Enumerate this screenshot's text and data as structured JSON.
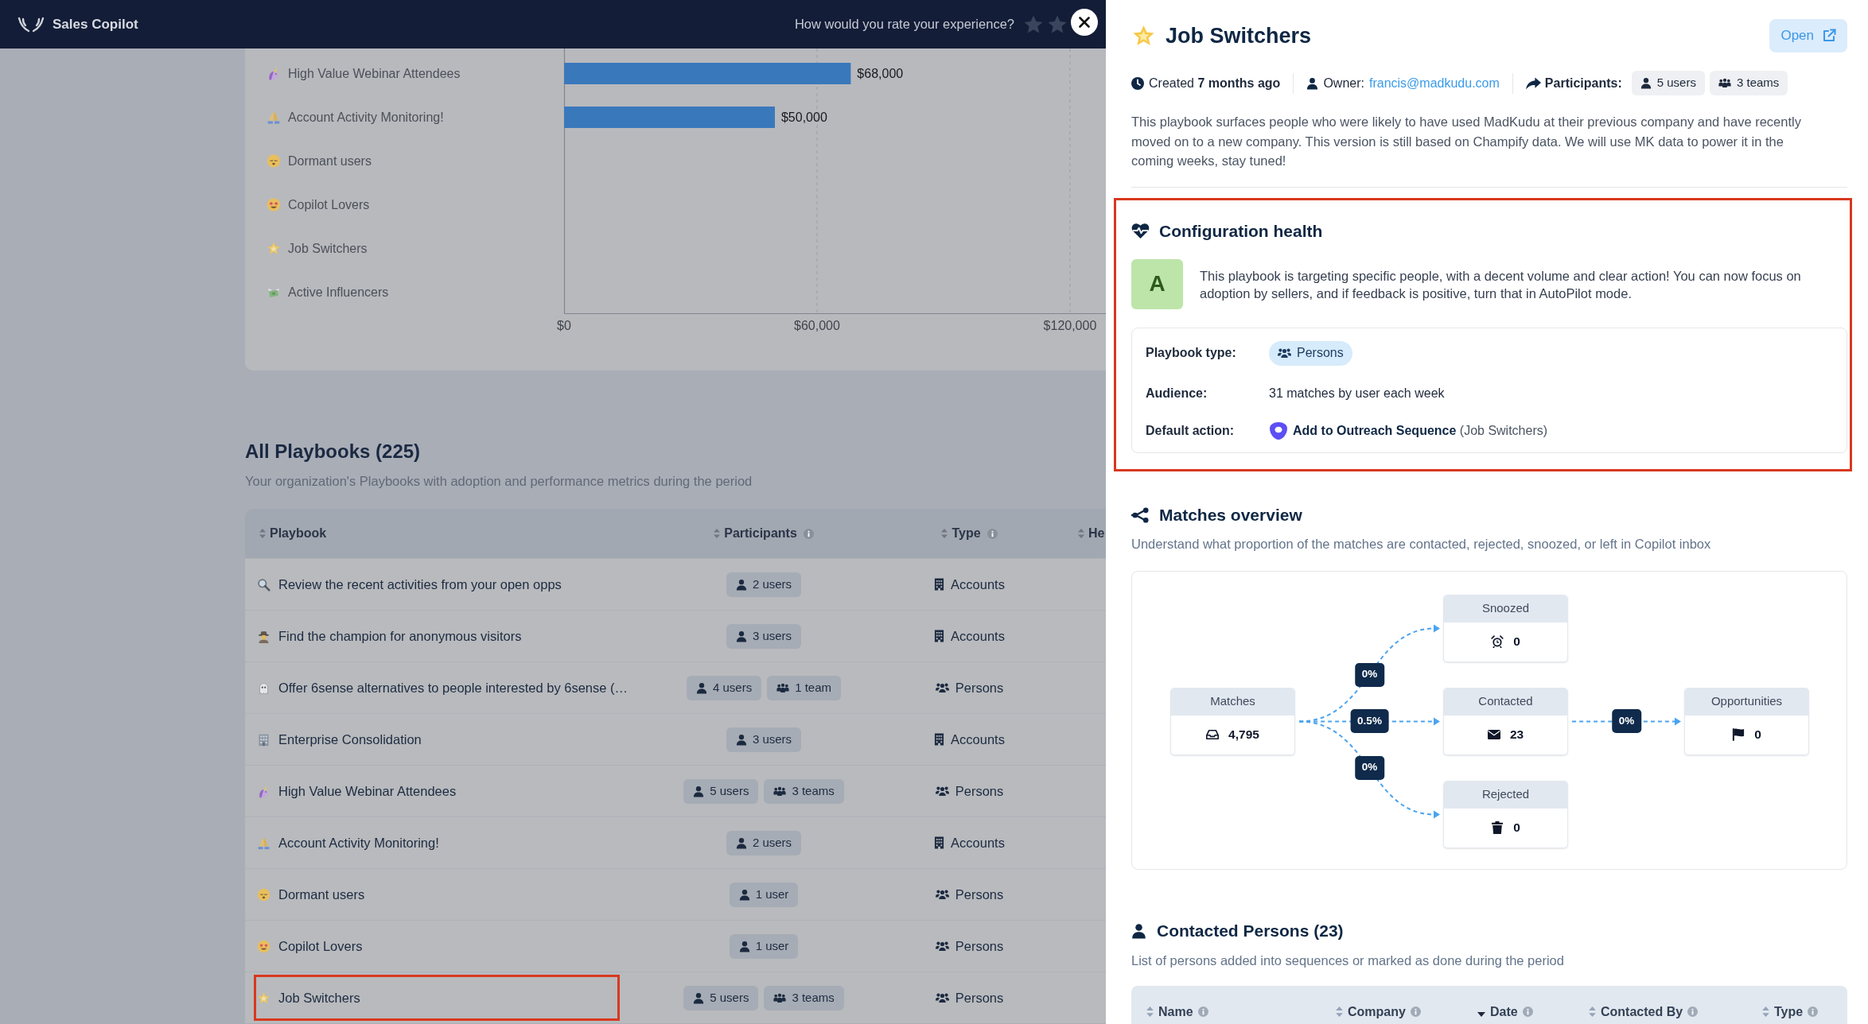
{
  "app_bar": {
    "title": "Sales Copilot",
    "rating_prompt": "How would you rate your experience?"
  },
  "spend_chart": {
    "chart_data": {
      "type": "bar",
      "orientation": "horizontal",
      "categories": [
        "High Value Webinar Attendees",
        "Account Activity Monitoring!",
        "Dormant users",
        "Copilot Lovers",
        "Job Switchers",
        "Active Influencers"
      ],
      "values": [
        68000,
        50000,
        0,
        0,
        0,
        0
      ],
      "value_labels": [
        "$68,000",
        "$50,000",
        null,
        null,
        null,
        null
      ],
      "xlim": [
        0,
        128500
      ],
      "xticks": [
        {
          "value": 0,
          "label": "$0"
        },
        {
          "value": 60000,
          "label": "$60,000"
        },
        {
          "value": 120000,
          "label": "$120,000"
        }
      ]
    }
  },
  "playbooks": {
    "title": "All Playbooks (225)",
    "subtitle": "Your organization's Playbooks with adoption and performance metrics during the period",
    "columns": [
      {
        "label": "Playbook",
        "info": false
      },
      {
        "label": "Participants",
        "info": true
      },
      {
        "label": "Type",
        "info": true
      },
      {
        "label": "He",
        "info": false
      }
    ],
    "rows": [
      {
        "name": "Review the recent activities from your open opps",
        "participants": [
          {
            "kind": "users",
            "label": "2 users"
          }
        ],
        "type": {
          "kind": "accounts",
          "label": "Accounts"
        },
        "highlighted": false
      },
      {
        "name": "Find the champion for anonymous visitors",
        "participants": [
          {
            "kind": "users",
            "label": "3 users"
          }
        ],
        "type": {
          "kind": "accounts",
          "label": "Accounts"
        },
        "highlighted": false
      },
      {
        "name": "Offer 6sense alternatives to people interested by 6sense (…",
        "participants": [
          {
            "kind": "users",
            "label": "4 users"
          },
          {
            "kind": "teams",
            "label": "1 team"
          }
        ],
        "type": {
          "kind": "persons",
          "label": "Persons"
        },
        "highlighted": false
      },
      {
        "name": "Enterprise Consolidation",
        "participants": [
          {
            "kind": "users",
            "label": "3 users"
          }
        ],
        "type": {
          "kind": "accounts",
          "label": "Accounts"
        },
        "highlighted": false
      },
      {
        "name": "High Value Webinar Attendees",
        "participants": [
          {
            "kind": "users",
            "label": "5 users"
          },
          {
            "kind": "teams",
            "label": "3 teams"
          }
        ],
        "type": {
          "kind": "persons",
          "label": "Persons"
        },
        "highlighted": false
      },
      {
        "name": "Account Activity Monitoring!",
        "participants": [
          {
            "kind": "users",
            "label": "2 users"
          }
        ],
        "type": {
          "kind": "accounts",
          "label": "Accounts"
        },
        "highlighted": false
      },
      {
        "name": "Dormant users",
        "participants": [
          {
            "kind": "users",
            "label": "1 user"
          }
        ],
        "type": {
          "kind": "persons",
          "label": "Persons"
        },
        "highlighted": false
      },
      {
        "name": "Copilot Lovers",
        "participants": [
          {
            "kind": "users",
            "label": "1 user"
          }
        ],
        "type": {
          "kind": "persons",
          "label": "Persons"
        },
        "highlighted": false
      },
      {
        "name": "Job Switchers",
        "participants": [
          {
            "kind": "users",
            "label": "5 users"
          },
          {
            "kind": "teams",
            "label": "3 teams"
          }
        ],
        "type": {
          "kind": "persons",
          "label": "Persons"
        },
        "highlighted": true
      }
    ]
  },
  "detail": {
    "title": "Job Switchers",
    "open_button": "Open",
    "meta": {
      "created": "Created **7 months ago**",
      "owner_label": "Owner:",
      "owner_email": "francis@madkudu.com",
      "participants_label": "Participants:",
      "participants": [
        {
          "kind": "users",
          "label": "5 users"
        },
        {
          "kind": "teams",
          "label": "3 teams"
        }
      ]
    },
    "description": "This playbook surfaces people who were likely to have used MadKudu at their previous company and have recently moved on to a new company. This version is still based on Champify data. We will use MK data to power it in the coming weeks, stay tuned!",
    "health": {
      "title": "Configuration health",
      "highlighted": true,
      "grade": "A",
      "summary": "This playbook is targeting specific people, with a decent volume and clear action! You can now focus on adoption by sellers, and if feedback is positive, turn that in AutoPilot mode.",
      "rows": [
        {
          "kind": "badge",
          "label": "Playbook type:",
          "value": "Persons"
        },
        {
          "kind": "text",
          "label": "Audience:",
          "value": "31 matches by user each week"
        },
        {
          "kind": "action",
          "label": "Default action:",
          "value": "**Add to Outreach Sequence** (Job Switchers)"
        }
      ]
    },
    "matches": {
      "title": "Matches overview",
      "subtitle": "Understand what proportion of the matches are contacted, rejected, snoozed, or left in Copilot inbox",
      "flow": {
        "label": "Matches",
        "value": "4,795",
        "children": [
          {
            "edge_label": "0%",
            "label": "Snoozed",
            "value": "0"
          },
          {
            "edge_label": "0.5%",
            "label": "Contacted",
            "value": "23",
            "children": [
              {
                "edge_label": "0%",
                "label": "Opportunities",
                "value": "0"
              }
            ]
          },
          {
            "edge_label": "0%",
            "label": "Rejected",
            "value": "0"
          }
        ]
      }
    },
    "contacted": {
      "title": "Contacted Persons (23)",
      "subtitle": "List of persons added into sequences or marked as done during the period",
      "columns": [
        {
          "label": "Name",
          "sorted": false,
          "info": true
        },
        {
          "label": "Company",
          "sorted": false,
          "info": true
        },
        {
          "label": "Date",
          "sorted": true,
          "info": true
        },
        {
          "label": "Contacted By",
          "sorted": false,
          "info": true
        },
        {
          "label": "Type",
          "sorted": false,
          "info": true
        }
      ]
    }
  }
}
